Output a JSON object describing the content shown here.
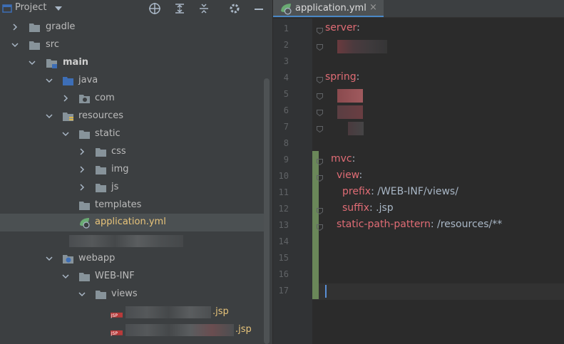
{
  "project_panel": {
    "title": "Project",
    "header_icons": [
      "project-window-icon",
      "dropdown-chevron-icon",
      "locate-icon",
      "expand-all-icon",
      "collapse-all-icon",
      "settings-gear-icon",
      "hide-minus-icon"
    ],
    "tree": [
      {
        "label": "gradle",
        "icon": "folder",
        "expanded": false
      },
      {
        "label": "src",
        "icon": "folder",
        "expanded": true
      },
      {
        "label": "main",
        "icon": "module-folder",
        "expanded": true,
        "bold": true
      },
      {
        "label": "java",
        "icon": "source-folder",
        "expanded": true
      },
      {
        "label": "com",
        "icon": "package",
        "expanded": false
      },
      {
        "label": "resources",
        "icon": "resources-folder",
        "expanded": true
      },
      {
        "label": "static",
        "icon": "folder",
        "expanded": true
      },
      {
        "label": "css",
        "icon": "folder",
        "expanded": false
      },
      {
        "label": "img",
        "icon": "folder",
        "expanded": false
      },
      {
        "label": "js",
        "icon": "folder",
        "expanded": false
      },
      {
        "label": "templates",
        "icon": "folder",
        "expanded": null
      },
      {
        "label": "application.yml",
        "icon": "spring-yml",
        "selected": true
      },
      {
        "label": "",
        "icon": "blurred"
      },
      {
        "label": "webapp",
        "icon": "web-folder",
        "expanded": true
      },
      {
        "label": "WEB-INF",
        "icon": "folder",
        "expanded": true
      },
      {
        "label": "views",
        "icon": "folder",
        "expanded": true
      },
      {
        "label": ".jsp",
        "icon": "jsp-file"
      },
      {
        "label": ".jsp",
        "icon": "jsp-file"
      }
    ]
  },
  "editor": {
    "tab": {
      "label": "application.yml",
      "close": "×"
    },
    "line_numbers": [
      "1",
      "2",
      "3",
      "4",
      "5",
      "6",
      "7",
      "8",
      "9",
      "10",
      "11",
      "12",
      "13",
      "14",
      "15",
      "16",
      "17"
    ],
    "lines": [
      {
        "key": "server",
        "sep": ":",
        "value": ""
      },
      {
        "key": "",
        "sep": "",
        "value": ""
      },
      {
        "key": "",
        "sep": "",
        "value": ""
      },
      {
        "key": "spring",
        "sep": ":",
        "value": ""
      },
      {
        "key": "",
        "sep": "",
        "value": ""
      },
      {
        "key": "",
        "sep": "",
        "value": ""
      },
      {
        "key": "",
        "sep": "",
        "value": ""
      },
      {
        "key": "",
        "sep": "",
        "value": ""
      },
      {
        "key": "mvc",
        "sep": ":",
        "value": ""
      },
      {
        "key": "view",
        "sep": ":",
        "value": ""
      },
      {
        "key": "prefix",
        "sep": ":",
        "value": " /WEB-INF/views/"
      },
      {
        "key": "suffix",
        "sep": ":",
        "value": " .jsp"
      },
      {
        "key": "static-path-pattern",
        "sep": ":",
        "value": " /resources/**"
      },
      {
        "key": "",
        "sep": "",
        "value": ""
      },
      {
        "key": "",
        "sep": "",
        "value": ""
      },
      {
        "key": "",
        "sep": "",
        "value": ""
      },
      {
        "key": "",
        "sep": "",
        "value": ""
      }
    ]
  },
  "colors": {
    "panel_bg": "#3c3f41",
    "editor_bg": "#2b2b2b",
    "selected_row": "#4b5052",
    "yaml_key": "#e06c75",
    "yaml_value": "#a9b7c6",
    "vcs_change": "#6a8759",
    "yml_file_label": "#e8c47a"
  }
}
